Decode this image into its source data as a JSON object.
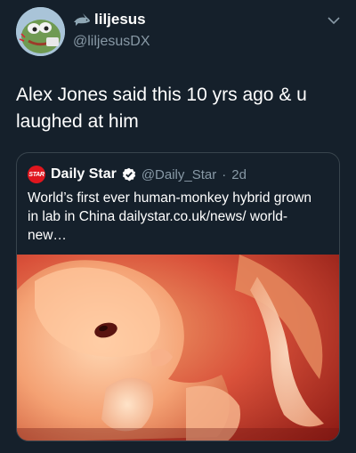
{
  "tweet": {
    "display_name": "liljesus",
    "handle": "@liljesusDX",
    "text": "Alex Jones said this 10 yrs ago & u laughed at him"
  },
  "quoted_tweet": {
    "logo_text": "STAR",
    "display_name": "Daily Star",
    "handle": "@Daily_Star",
    "separator": "·",
    "time": "2d",
    "text": "World’s first ever human-monkey hybrid grown in lab in China dailystar.co.uk/news/ world-new…"
  },
  "icons": {
    "name_emoji": "shark-emoji-icon",
    "verified": "verified-badge-icon",
    "menu": "chevron-down-icon"
  },
  "colors": {
    "background": "#15202b",
    "secondary_text": "#8899a6",
    "border": "#38444d",
    "verified": "#ffffff",
    "logo_red": "#e0161e"
  }
}
